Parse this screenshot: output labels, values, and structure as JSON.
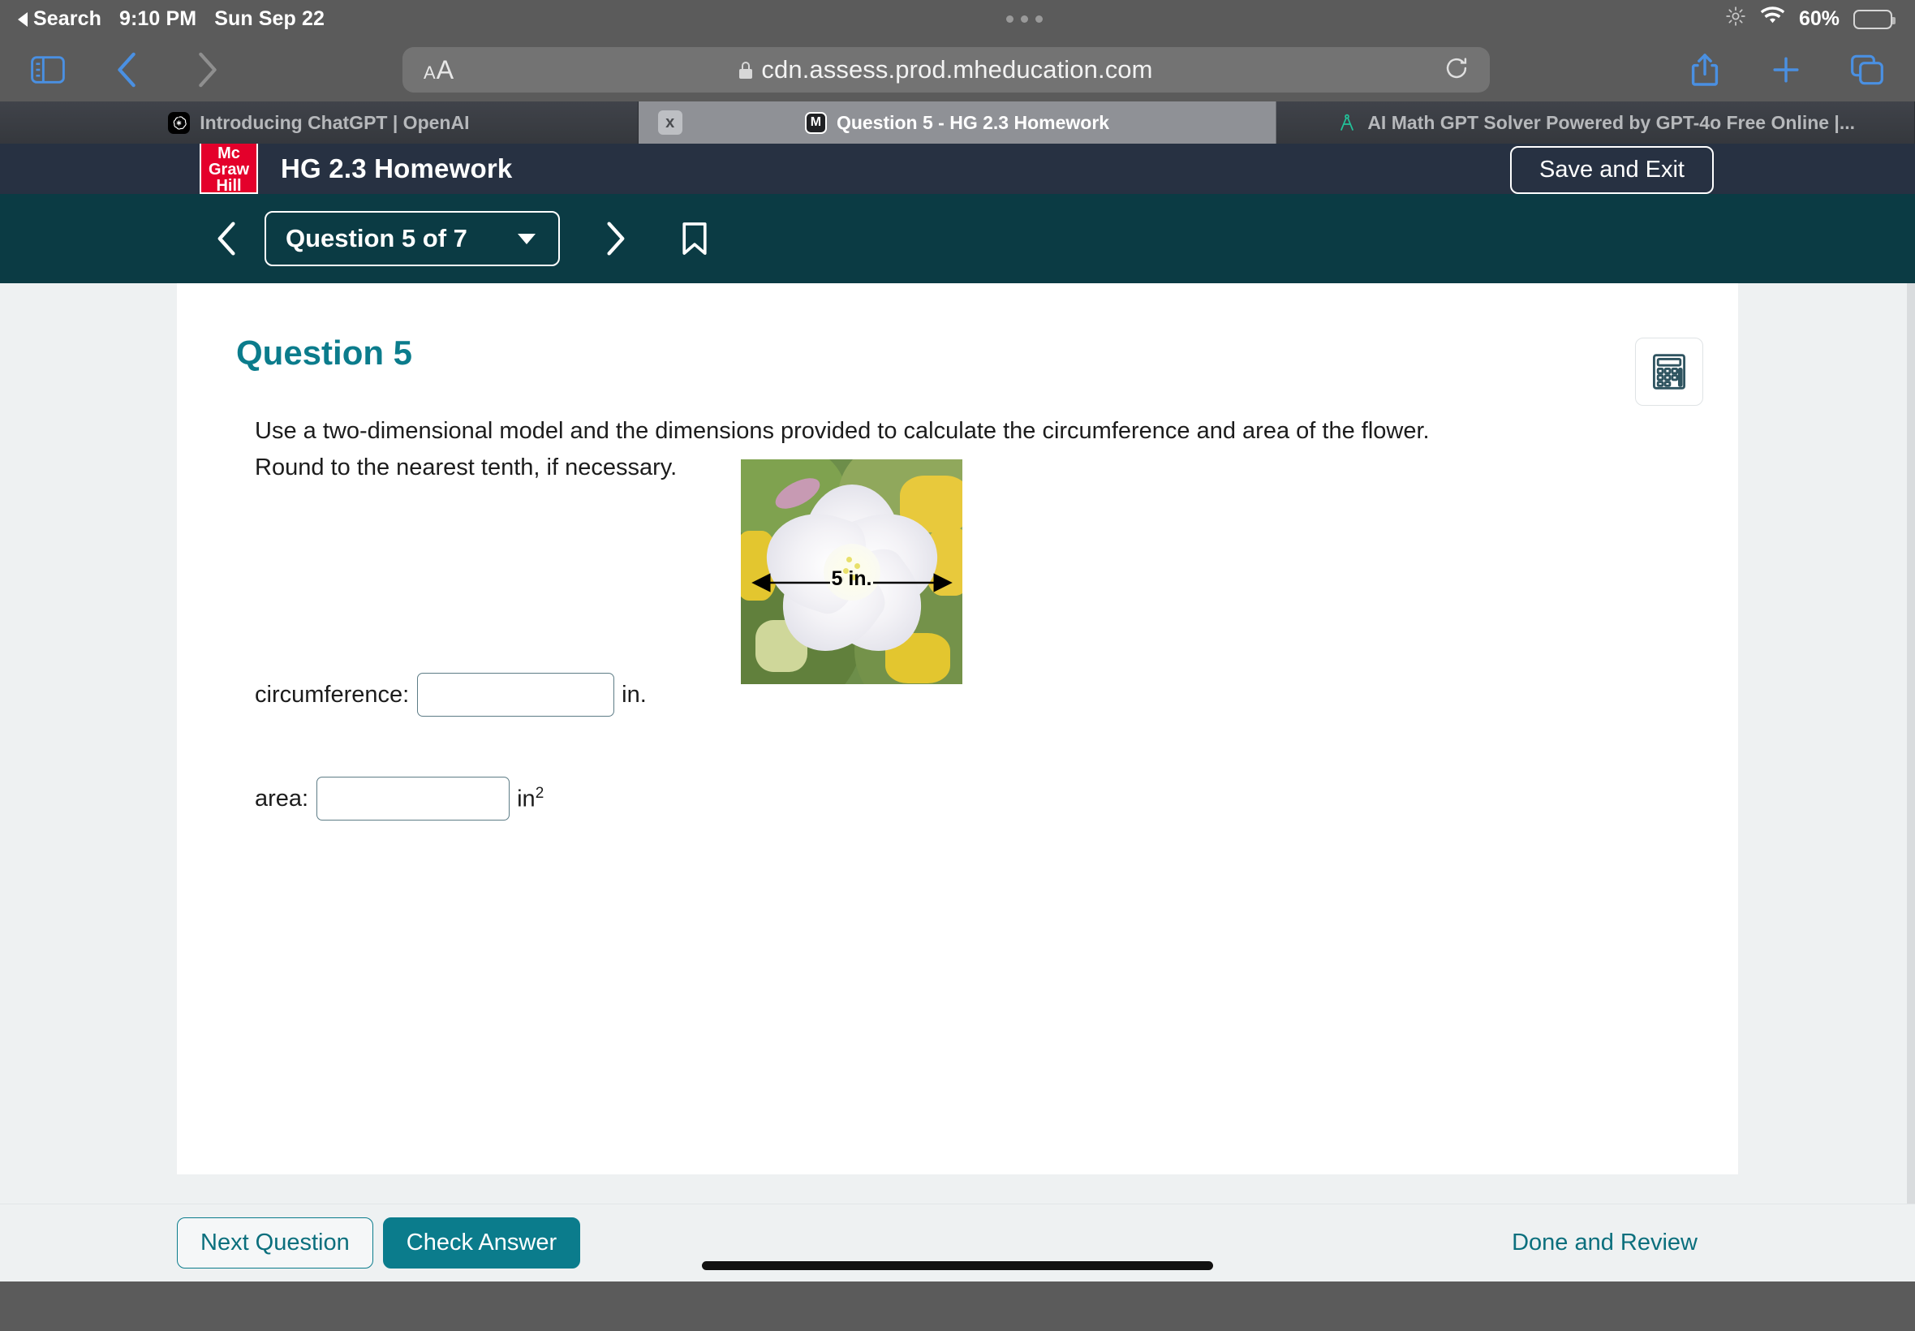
{
  "status_bar": {
    "back_label": "Search",
    "time": "9:10 PM",
    "date": "Sun Sep 22",
    "battery_percent": "60%"
  },
  "browser": {
    "icons": {
      "sidebar": "sidebar-icon",
      "back": "back-chevron-icon",
      "forward": "forward-chevron-icon",
      "text_size": "aa-text-size-icon",
      "reload": "reload-icon",
      "share": "share-icon",
      "new_tab": "plus-icon",
      "tabs_overview": "tabs-overview-icon"
    },
    "url": "cdn.assess.prod.mheducation.com",
    "aa_small": "A",
    "aa_big": "A",
    "tabs": [
      {
        "title": "Introducing ChatGPT | OpenAI",
        "favicon": "openai-logo-icon",
        "active": false
      },
      {
        "title": "Question 5 - HG 2.3 Homework",
        "favicon": "mcgraw-hill-m-icon",
        "active": true,
        "close_label": "x"
      },
      {
        "title": "AI Math GPT Solver Powered by GPT-4o Free Online |...",
        "favicon": "compass-icon",
        "active": false
      }
    ]
  },
  "app_header": {
    "logo_text": "Mc Graw Hill",
    "logo_lines": [
      "Mc",
      "Graw",
      "Hill"
    ],
    "title": "HG 2.3 Homework",
    "save_exit_label": "Save and Exit",
    "brand_red": "#e4002b",
    "header_bg": "#273142"
  },
  "question_nav": {
    "prev_label": "prev-question",
    "next_label": "next-question",
    "selector_label": "Question 5 of 7",
    "bookmark_label": "bookmark",
    "bar_bg": "#0b3b44"
  },
  "content": {
    "question_title": "Question 5",
    "accent_color": "#0b7c8c",
    "prompt_line1": "Use a two-dimensional model and the dimensions provided to calculate the circumference and area of the flower.",
    "prompt_line2": "Round to the nearest tenth, if necessary.",
    "figure": {
      "alt": "Photograph of a white bindweed flower with a horizontal double-headed arrow across the bloom",
      "dimension_label": "5 in."
    },
    "answers": [
      {
        "label": "circumference:",
        "value": "",
        "placeholder": "",
        "unit": "in.",
        "exponent": ""
      },
      {
        "label": "area:",
        "value": "",
        "placeholder": "",
        "unit": "in",
        "exponent": "2"
      }
    ],
    "calculator_icon": "calculator-icon"
  },
  "bottom_bar": {
    "next_question_label": "Next Question",
    "check_answer_label": "Check Answer",
    "done_review_label": "Done and Review"
  }
}
